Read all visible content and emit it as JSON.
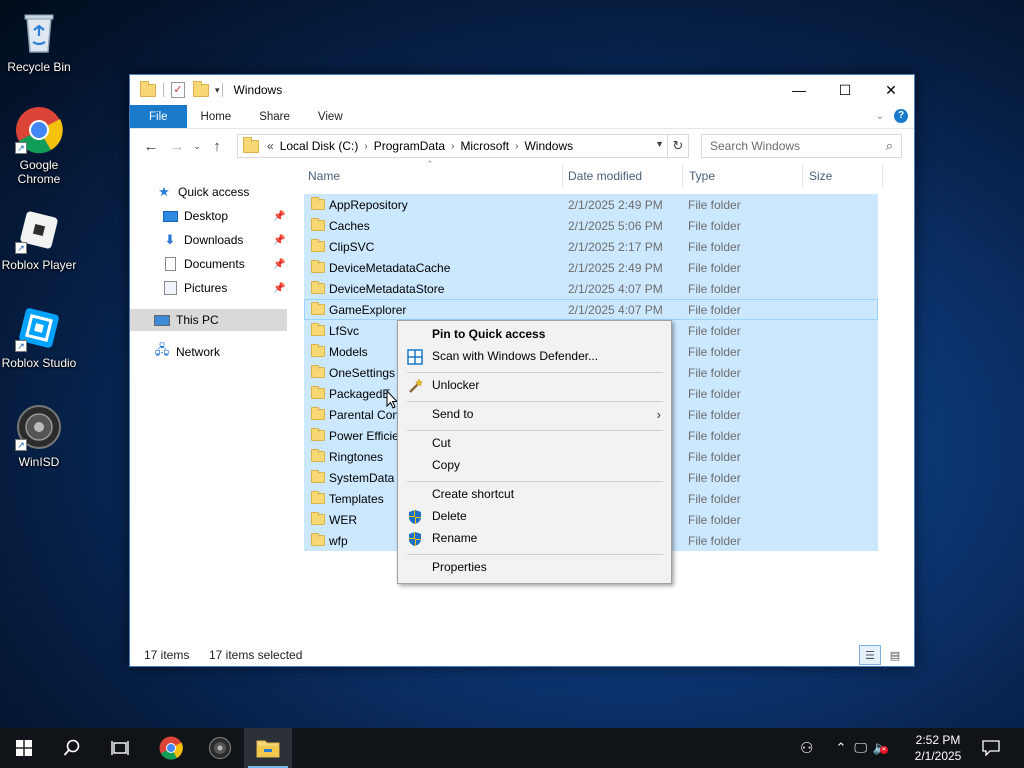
{
  "desktop": {
    "icons": [
      {
        "label": "Recycle Bin",
        "icon": "recycle-bin-icon"
      },
      {
        "label": "Google Chrome",
        "icon": "chrome-icon"
      },
      {
        "label": "Roblox Player",
        "icon": "roblox-player-icon"
      },
      {
        "label": "Roblox Studio",
        "icon": "roblox-studio-icon"
      },
      {
        "label": "WinISD",
        "icon": "speaker-icon"
      }
    ]
  },
  "window": {
    "title": "Windows",
    "controls": {
      "minimize": "—",
      "maximize": "☐",
      "close": "✕"
    },
    "ribbon_tabs": [
      "File",
      "Home",
      "Share",
      "View"
    ],
    "address": {
      "overflow": "«",
      "crumbs": [
        "Local Disk (C:)",
        "ProgramData",
        "Microsoft",
        "Windows"
      ]
    },
    "search_placeholder": "Search Windows"
  },
  "nav": {
    "quick_access": "Quick access",
    "quick_items": [
      {
        "label": "Desktop",
        "icon": "desktop-icon"
      },
      {
        "label": "Downloads",
        "icon": "downloads-icon"
      },
      {
        "label": "Documents",
        "icon": "documents-icon"
      },
      {
        "label": "Pictures",
        "icon": "pictures-icon"
      }
    ],
    "this_pc": "This PC",
    "network": "Network"
  },
  "columns": [
    "Name",
    "Date modified",
    "Type",
    "Size"
  ],
  "files": [
    {
      "name": "AppRepository",
      "date": "2/1/2025 2:49 PM",
      "type": "File folder"
    },
    {
      "name": "Caches",
      "date": "2/1/2025 5:06 PM",
      "type": "File folder"
    },
    {
      "name": "ClipSVC",
      "date": "2/1/2025 2:17 PM",
      "type": "File folder"
    },
    {
      "name": "DeviceMetadataCache",
      "date": "2/1/2025 2:49 PM",
      "type": "File folder"
    },
    {
      "name": "DeviceMetadataStore",
      "date": "2/1/2025 4:07 PM",
      "type": "File folder"
    },
    {
      "name": "GameExplorer",
      "date": "2/1/2025 4:07 PM",
      "type": "File folder"
    },
    {
      "name": "LfSvc",
      "date": "",
      "type": "File folder"
    },
    {
      "name": "Models",
      "date": "",
      "type": "File folder"
    },
    {
      "name": "OneSettings",
      "date": "",
      "type": "File folder"
    },
    {
      "name": "PackagedE",
      "date": "",
      "type": "File folder"
    },
    {
      "name": "Parental Con",
      "date": "",
      "type": "File folder"
    },
    {
      "name": "Power Efficie",
      "date": "",
      "type": "File folder"
    },
    {
      "name": "Ringtones",
      "date": "",
      "type": "File folder"
    },
    {
      "name": "SystemData",
      "date": "",
      "type": "File folder"
    },
    {
      "name": "Templates",
      "date": "",
      "type": "File folder"
    },
    {
      "name": "WER",
      "date": "",
      "type": "File folder"
    },
    {
      "name": "wfp",
      "date": "",
      "type": "File folder"
    }
  ],
  "status": {
    "count": "17 items",
    "selected": "17 items selected"
  },
  "context_menu": {
    "pin": "Pin to Quick access",
    "scan": "Scan with Windows Defender...",
    "unlocker": "Unlocker",
    "send_to": "Send to",
    "cut": "Cut",
    "copy": "Copy",
    "create_shortcut": "Create shortcut",
    "delete": "Delete",
    "rename": "Rename",
    "properties": "Properties"
  },
  "taskbar": {
    "time": "2:52 PM",
    "date": "2/1/2025"
  },
  "colors": {
    "selection": "#cce8ff",
    "accent": "#1979ca",
    "folder": "#f8d775"
  }
}
